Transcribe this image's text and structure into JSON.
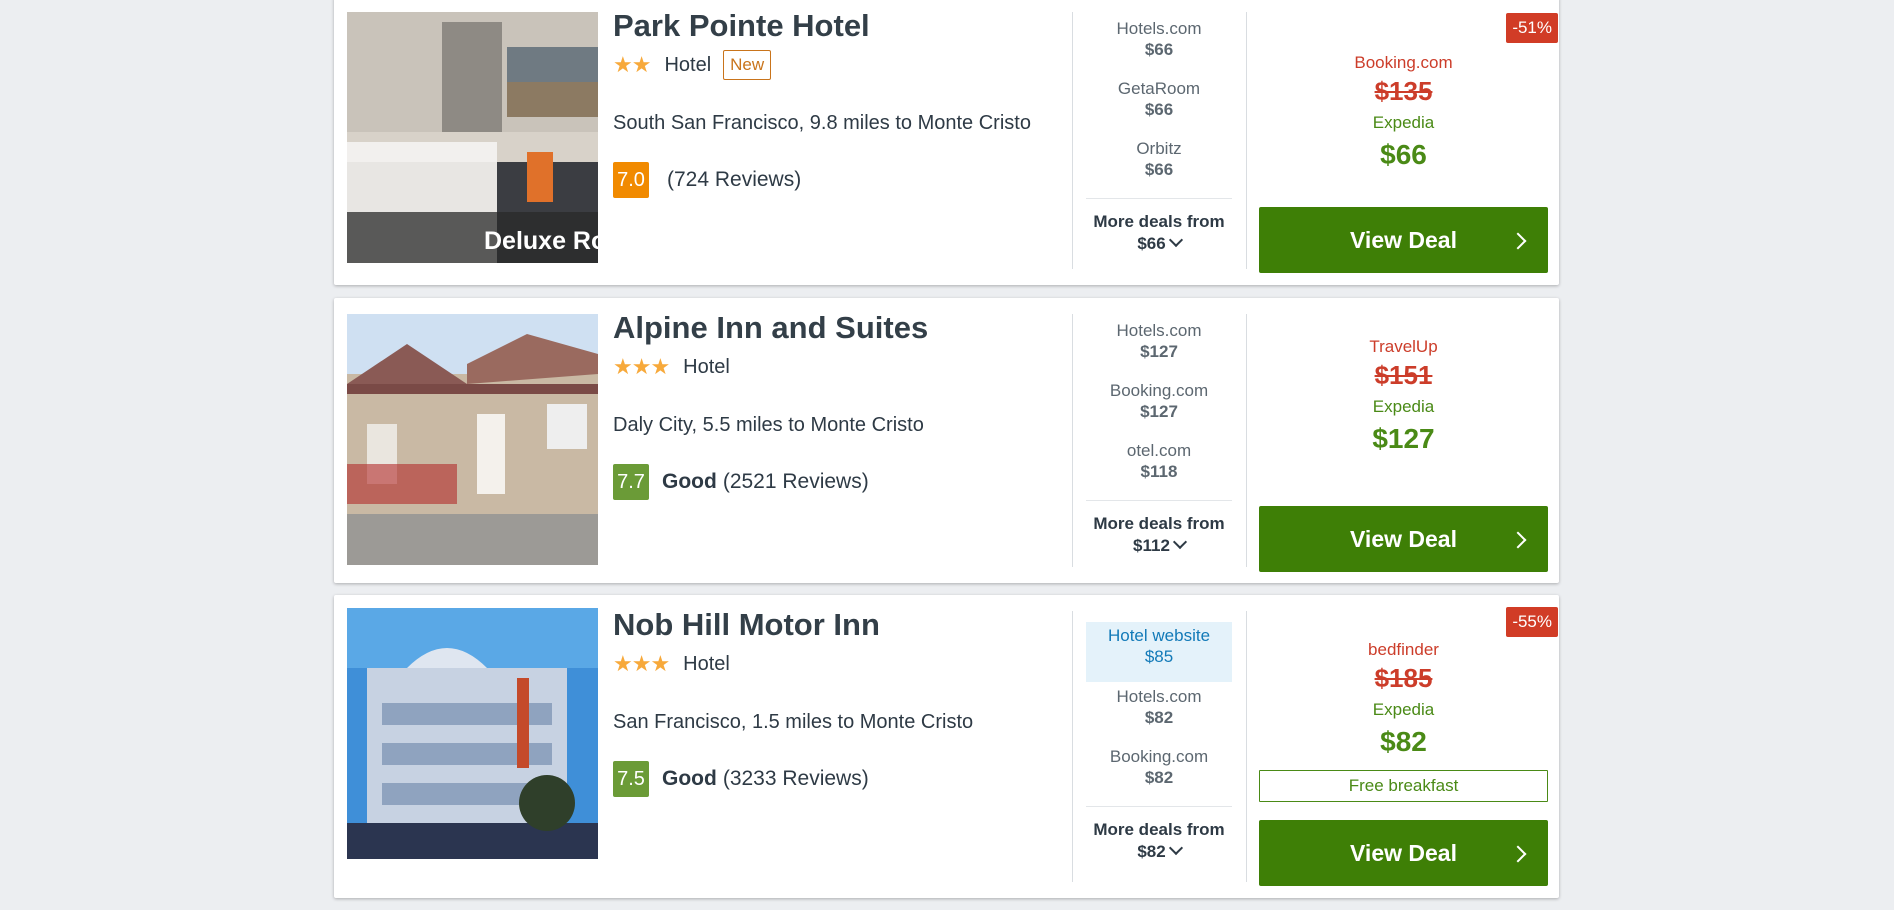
{
  "hotels": [
    {
      "name": "Park Pointe Hotel",
      "stars": "★★",
      "type": "Hotel",
      "badge": "New",
      "location": "South San Francisco, 9.8 miles to Monte Cristo",
      "score": "7.0",
      "rating_word": "",
      "reviews": "(724 Reviews)",
      "photo_caption": "Deluxe Ro",
      "deals": [
        {
          "provider": "Hotels.com",
          "price": "$66"
        },
        {
          "provider": "GetaRoom",
          "price": "$66"
        },
        {
          "provider": "Orbitz",
          "price": "$66"
        }
      ],
      "more_deals_label": "More deals from",
      "more_deals_price": "$66",
      "discount": "-51%",
      "offer_strike_provider": "Booking.com",
      "offer_strike_price": "$135",
      "offer_provider": "Expedia",
      "offer_price": "$66",
      "button": "View Deal"
    },
    {
      "name": "Alpine Inn and Suites",
      "stars": "★★★",
      "type": "Hotel",
      "location": "Daly City, 5.5 miles to Monte Cristo",
      "score": "7.7",
      "rating_word": "Good",
      "reviews": "(2521 Reviews)",
      "deals": [
        {
          "provider": "Hotels.com",
          "price": "$127"
        },
        {
          "provider": "Booking.com",
          "price": "$127"
        },
        {
          "provider": "otel.com",
          "price": "$118"
        }
      ],
      "more_deals_label": "More deals from",
      "more_deals_price": "$112",
      "offer_strike_provider": "TravelUp",
      "offer_strike_price": "$151",
      "offer_provider": "Expedia",
      "offer_price": "$127",
      "button": "View Deal"
    },
    {
      "name": "Nob Hill Motor Inn",
      "stars": "★★★",
      "type": "Hotel",
      "location": "San Francisco, 1.5 miles to Monte Cristo",
      "score": "7.5",
      "rating_word": "Good",
      "reviews": "(3233 Reviews)",
      "deals": [
        {
          "provider": "Hotel website",
          "price": "$85"
        },
        {
          "provider": "Hotels.com",
          "price": "$82"
        },
        {
          "provider": "Booking.com",
          "price": "$82"
        }
      ],
      "more_deals_label": "More deals from",
      "more_deals_price": "$82",
      "discount": "-55%",
      "offer_strike_provider": "bedfinder",
      "offer_strike_price": "$185",
      "offer_provider": "Expedia",
      "offer_price": "$82",
      "perk": "Free breakfast",
      "button": "View Deal"
    }
  ],
  "colors": {
    "deal_green": "#3e7f06",
    "price_green": "#4a8a16",
    "strike_red": "#cc3d2a",
    "star_orange": "#f7a93b",
    "score_orange": "#f18a00",
    "score_green": "#6b9b37"
  }
}
